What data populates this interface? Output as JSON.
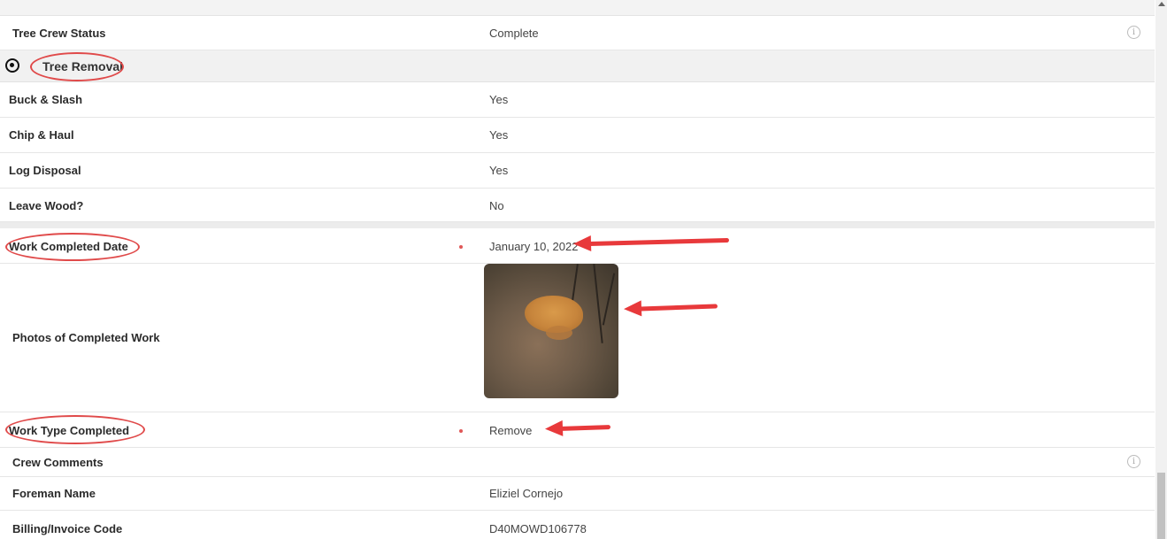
{
  "top_fields": [
    {
      "label": "Tree Crew Status",
      "value": "Complete"
    }
  ],
  "section": {
    "title": "Tree Removal",
    "toggle_icon": "eye-icon"
  },
  "section_fields": [
    {
      "label": "Buck & Slash",
      "value": "Yes"
    },
    {
      "label": "Chip & Haul",
      "value": "Yes"
    },
    {
      "label": "Log Disposal",
      "value": "Yes"
    },
    {
      "label": "Leave Wood?",
      "value": "No"
    }
  ],
  "work": {
    "completed_date": {
      "label": "Work Completed Date",
      "value": "January 10, 2022"
    },
    "photos": {
      "label": "Photos of Completed Work"
    },
    "type_completed": {
      "label": "Work Type Completed",
      "value": "Remove"
    },
    "crew_comments": {
      "label": "Crew Comments",
      "value": ""
    },
    "foreman": {
      "label": "Foreman Name",
      "value": "Eliziel Cornejo"
    },
    "billing_code": {
      "label": "Billing/Invoice Code",
      "value": "D40MOWD106778"
    }
  },
  "icons": {
    "info": "info-icon"
  },
  "colors": {
    "annotation": "#e8393b",
    "required_dot": "#e05757",
    "section_bg": "#f1f1f1"
  }
}
